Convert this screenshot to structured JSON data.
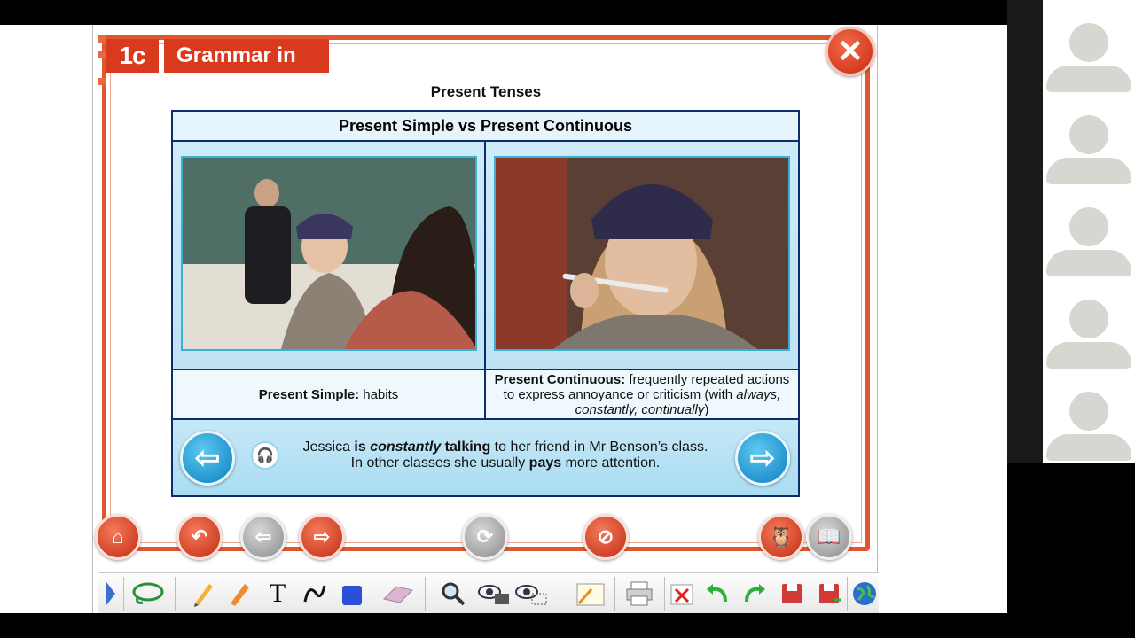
{
  "header": {
    "unit": "1c",
    "title": "Grammar in use"
  },
  "heading": "Present Tenses",
  "table": {
    "title": "Present Simple vs Present Continuous",
    "left_term": "Present Simple:",
    "left_desc": " habits",
    "right_term": "Present Continuous:",
    "right_desc_1": " frequently repeated actions to express annoyance or criticism (with ",
    "right_emph": "always, constantly, continually",
    "right_desc_2": ")"
  },
  "example": {
    "p1": "Jessica ",
    "b1": "is ",
    "bi1": "constantly",
    "b2": " talking",
    "p2": " to her friend in Mr Benson’s class.",
    "p3": "In other classes she usually ",
    "b3": "pays",
    "p4": " more attention."
  },
  "icons": {
    "close": "✕",
    "prev": "⇦",
    "next": "⇨",
    "home": "⌂",
    "undo": "↶",
    "back": "⇦",
    "forward": "⇨",
    "refresh": "⟳",
    "no_subtitles": "⊘",
    "owl": "🦉",
    "book": "📖",
    "headphones": "🎧"
  },
  "colors": {
    "accent_red": "#e2552e",
    "table_border": "#0d2c6b",
    "nav_blue": "#0a7fc0"
  }
}
